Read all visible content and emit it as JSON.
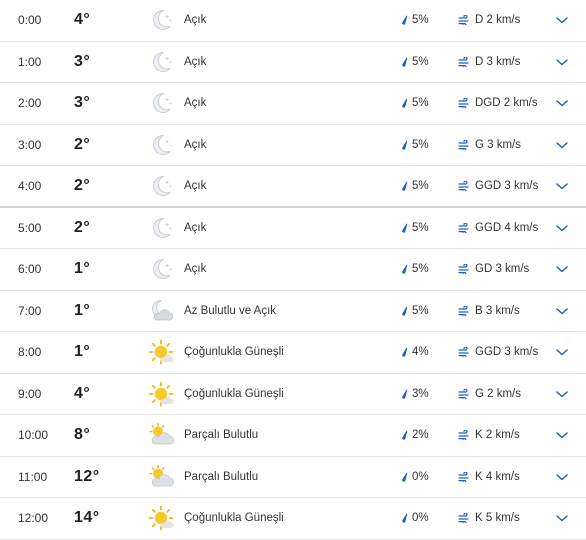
{
  "colors": {
    "accent": "#1f5fbf",
    "divider": "#e3e3e3",
    "text": "#2b2b2b"
  },
  "rows": [
    {
      "time": "0:00",
      "temp": "4°",
      "icon": "moon-clear-icon",
      "condition": "Açık",
      "precip": "5%",
      "wind": "D 2 km/s"
    },
    {
      "time": "1:00",
      "temp": "3°",
      "icon": "moon-clear-icon",
      "condition": "Açık",
      "precip": "5%",
      "wind": "D 3 km/s"
    },
    {
      "time": "2:00",
      "temp": "3°",
      "icon": "moon-clear-icon",
      "condition": "Açık",
      "precip": "5%",
      "wind": "DGD 2 km/s"
    },
    {
      "time": "3:00",
      "temp": "2°",
      "icon": "moon-clear-icon",
      "condition": "Açık",
      "precip": "5%",
      "wind": "G 3 km/s"
    },
    {
      "time": "4:00",
      "temp": "2°",
      "icon": "moon-clear-icon",
      "condition": "Açık",
      "precip": "5%",
      "wind": "GGD 3 km/s"
    },
    {
      "time": "5:00",
      "temp": "2°",
      "icon": "moon-clear-icon",
      "condition": "Açık",
      "precip": "5%",
      "wind": "GGD 4 km/s"
    },
    {
      "time": "6:00",
      "temp": "1°",
      "icon": "moon-clear-icon",
      "condition": "Açık",
      "precip": "5%",
      "wind": "GD 3 km/s"
    },
    {
      "time": "7:00",
      "temp": "1°",
      "icon": "moon-cloud-icon",
      "condition": "Az Bulutlu ve Açık",
      "precip": "5%",
      "wind": "B 3 km/s"
    },
    {
      "time": "8:00",
      "temp": "1°",
      "icon": "sun-icon",
      "condition": "Çoğunlukla Güneşli",
      "precip": "4%",
      "wind": "GGD 3 km/s"
    },
    {
      "time": "9:00",
      "temp": "4°",
      "icon": "sun-icon",
      "condition": "Çoğunlukla Güneşli",
      "precip": "3%",
      "wind": "G 2 km/s"
    },
    {
      "time": "10:00",
      "temp": "8°",
      "icon": "sun-cloud-icon",
      "condition": "Parçalı Bulutlu",
      "precip": "2%",
      "wind": "K 2 km/s"
    },
    {
      "time": "11:00",
      "temp": "12°",
      "icon": "sun-cloud-icon",
      "condition": "Parçalı Bulutlu",
      "precip": "0%",
      "wind": "K 4 km/s"
    },
    {
      "time": "12:00",
      "temp": "14°",
      "icon": "sun-icon",
      "condition": "Çoğunlukla Güneşli",
      "precip": "0%",
      "wind": "K 5 km/s"
    }
  ]
}
